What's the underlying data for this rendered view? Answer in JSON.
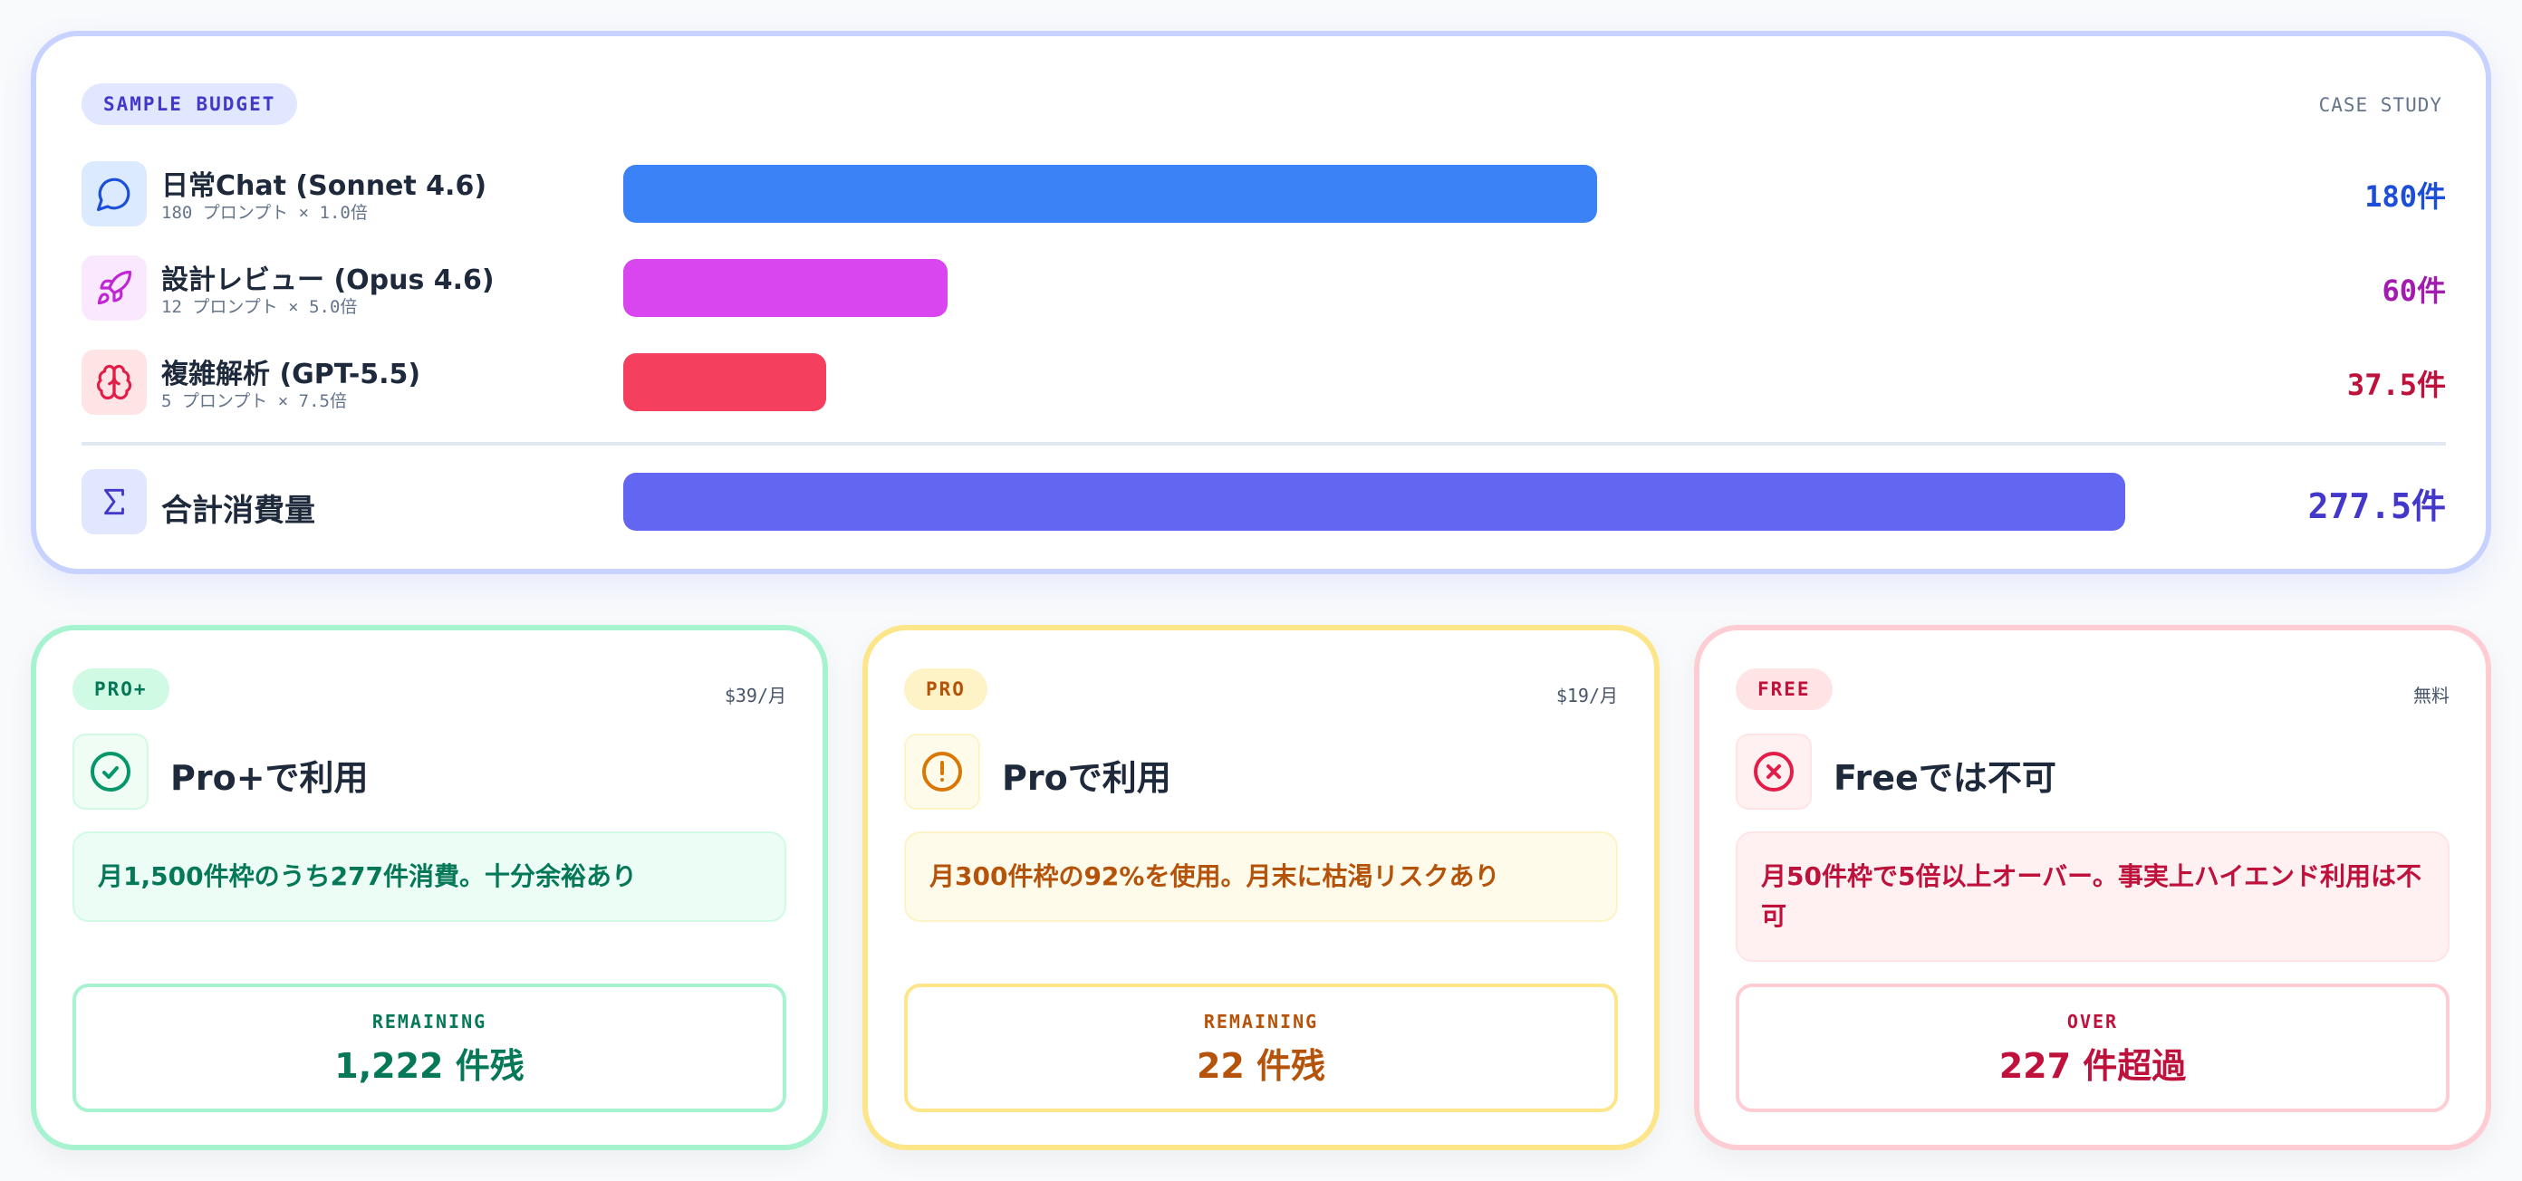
{
  "budget": {
    "badge": "SAMPLE BUDGET",
    "case_label": "CASE STUDY",
    "rows": [
      {
        "name": "日常Chat (Sonnet 4.6)",
        "sub": "180 プロンプト × 1.0倍",
        "value_label": "180件",
        "value": 180,
        "icon": "chat-bubble-icon",
        "color": "#3b82f6",
        "text_color": "#1d4ed8",
        "icon_bg": "#dbeafe"
      },
      {
        "name": "設計レビュー (Opus 4.6)",
        "sub": "12 プロンプト × 5.0倍",
        "value_label": "60件",
        "value": 60,
        "icon": "rocket-icon",
        "color": "#d946ef",
        "text_color": "#a21caf",
        "icon_bg": "#fae8ff"
      },
      {
        "name": "複雑解析 (GPT-5.5)",
        "sub": "5 プロンプト × 7.5倍",
        "value_label": "37.5件",
        "value": 37.5,
        "icon": "brain-icon",
        "color": "#f43f5e",
        "text_color": "#be123c",
        "icon_bg": "#ffe4e6"
      }
    ],
    "total": {
      "name": "合計消費量",
      "value_label": "277.5件",
      "value": 277.5,
      "icon": "sigma-icon",
      "color": "#6366f1",
      "text_color": "#4338ca",
      "icon_bg": "#e0e7ff"
    }
  },
  "plans": [
    {
      "badge": "PRO+",
      "price": "$39/月",
      "heading": "Pro+で利用",
      "icon": "check-circle-icon",
      "note": "月1,500件枠のうち277件消費。十分余裕あり",
      "result_label": "REMAINING",
      "result_value": "1,222 件残",
      "colors": {
        "accent": "#047857",
        "icon": "#059669",
        "badge_bg": "#d1fae5",
        "note_bg": "#ecfdf5",
        "note_border": "#d1fae5",
        "result_border": "#a7f3d0",
        "icon_bg": "#f0fdf4",
        "icon_border": "#d1fae5"
      }
    },
    {
      "badge": "PRO",
      "price": "$19/月",
      "heading": "Proで利用",
      "icon": "alert-circle-icon",
      "note": "月300件枠の92%を使用。月末に枯渇リスクあり",
      "result_label": "REMAINING",
      "result_value": "22 件残",
      "colors": {
        "accent": "#b45309",
        "icon": "#d97706",
        "badge_bg": "#fef3c7",
        "note_bg": "#fffbeb",
        "note_border": "#fef3c7",
        "result_border": "#fde68a",
        "icon_bg": "#fffbeb",
        "icon_border": "#fef3c7"
      }
    },
    {
      "badge": "FREE",
      "price": "無料",
      "heading": "Freeでは不可",
      "icon": "x-circle-icon",
      "note": "月50件枠で5倍以上オーバー。事実上ハイエンド利用は不可",
      "result_label": "OVER",
      "result_value": "227 件超過",
      "colors": {
        "accent": "#be123c",
        "icon": "#e11d48",
        "badge_bg": "#ffe4e6",
        "note_bg": "#fff1f2",
        "note_border": "#ffe4e6",
        "result_border": "#fecdd3",
        "icon_bg": "#fff1f2",
        "icon_border": "#ffe4e6"
      }
    }
  ]
}
